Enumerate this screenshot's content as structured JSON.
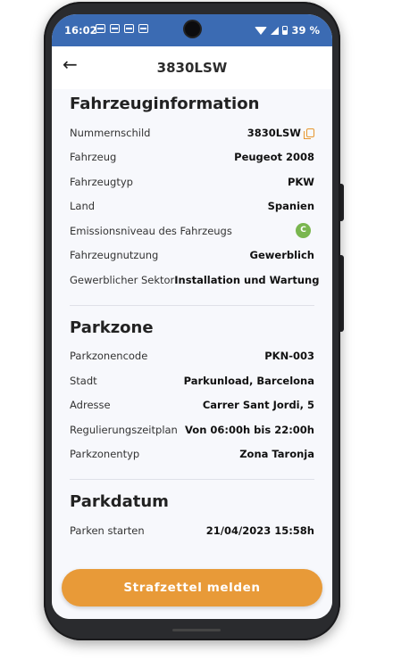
{
  "status": {
    "time": "16:02",
    "battery": "39 %"
  },
  "header": {
    "back_icon": "arrow-left-icon",
    "title": "3830LSW"
  },
  "vehicle": {
    "title": "Fahrzeuginformation",
    "rows": [
      {
        "label": "Nummernschild",
        "value": "3830LSW"
      },
      {
        "label": "Fahrzeug",
        "value": "Peugeot 2008"
      },
      {
        "label": "Fahrzeugtyp",
        "value": "PKW"
      },
      {
        "label": "Land",
        "value": "Spanien"
      },
      {
        "label": "Emissionsniveau des Fahrzeugs",
        "value": "C"
      },
      {
        "label": "Fahrzeugnutzung",
        "value": "Gewerblich"
      },
      {
        "label": "Gewerblicher Sektor",
        "value": "Installation und Wartung"
      }
    ]
  },
  "zone": {
    "title": "Parkzone",
    "rows": [
      {
        "label": "Parkzonencode",
        "value": "PKN-003"
      },
      {
        "label": "Stadt",
        "value": "Parkunload, Barcelona"
      },
      {
        "label": "Adresse",
        "value": "Carrer Sant Jordi, 5"
      },
      {
        "label": "Regulierungszeitplan",
        "value": "Von 06:00h bis 22:00h"
      },
      {
        "label": "Parkzonentyp",
        "value": "Zona Taronja"
      }
    ]
  },
  "date": {
    "title": "Parkdatum",
    "rows": [
      {
        "label": "Parken starten",
        "value": "21/04/2023 15:58h"
      }
    ]
  },
  "action": {
    "report_label": "Strafzettel melden"
  },
  "colors": {
    "status_bar": "#3b6bb3",
    "accent": "#e89a38",
    "emission_badge": "#7ab64f"
  }
}
